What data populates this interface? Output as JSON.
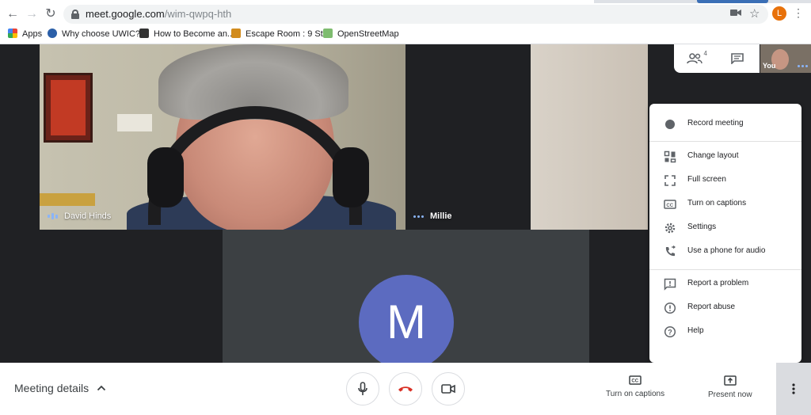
{
  "browser": {
    "url_host": "meet.google.com",
    "url_path": "/wim-qwpq-hth",
    "profile_initial": "L",
    "bookmarks": [
      {
        "label": "Apps",
        "icon": "apps-grid-icon"
      },
      {
        "label": "Why choose UWIC?...",
        "icon": "globe-icon"
      },
      {
        "label": "How to Become an...",
        "icon": "sej-icon"
      },
      {
        "label": "Escape Room : 9 St...",
        "icon": "escape-room-icon"
      },
      {
        "label": "OpenStreetMap",
        "icon": "osm-icon"
      }
    ]
  },
  "participants": {
    "david": {
      "name": "David Hinds"
    },
    "millie": {
      "name": "Millie"
    },
    "you": {
      "label": "You"
    },
    "m_tile": {
      "initial": "M",
      "color": "#5c6bc0"
    },
    "count_badge": "4"
  },
  "menu": {
    "items": [
      {
        "label": "Record meeting",
        "icon": "record-icon"
      },
      {
        "label": "Change layout",
        "icon": "layout-icon"
      },
      {
        "label": "Full screen",
        "icon": "fullscreen-icon"
      },
      {
        "label": "Turn on captions",
        "icon": "captions-icon"
      },
      {
        "label": "Settings",
        "icon": "gear-icon"
      },
      {
        "label": "Use a phone for audio",
        "icon": "phone-icon"
      },
      {
        "label": "Report a problem",
        "icon": "report-icon"
      },
      {
        "label": "Report abuse",
        "icon": "alert-icon"
      },
      {
        "label": "Help",
        "icon": "help-icon"
      }
    ]
  },
  "bottom_bar": {
    "meeting_details": "Meeting details",
    "captions_label": "Turn on captions",
    "present_label": "Present now"
  },
  "colors": {
    "stage_bg": "#202124",
    "hangup_red": "#d93025",
    "speaking_blue": "#8ab4f8"
  }
}
